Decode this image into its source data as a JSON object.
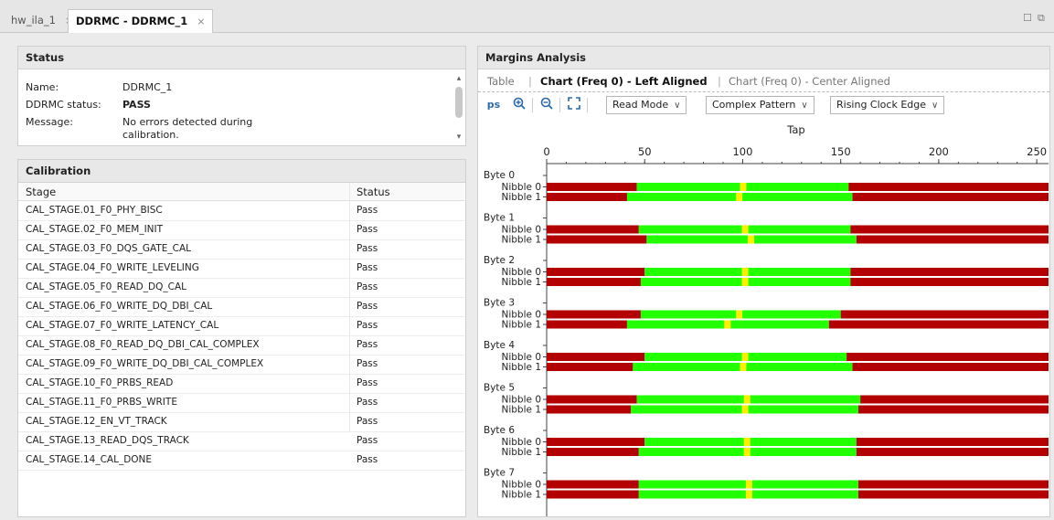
{
  "tabs": [
    {
      "label": "hw_ila_1",
      "close": "×"
    },
    {
      "label": "DDRMC - DDRMC_1",
      "close": "×"
    }
  ],
  "window_controls": {
    "restore": "☐",
    "float": "⧉"
  },
  "status": {
    "title": "Status",
    "name_label": "Name:",
    "name_value": "DDRMC_1",
    "ddrmc_status_label": "DDRMC status:",
    "ddrmc_status_value": "PASS",
    "message_label": "Message:",
    "message_line1": "No errors detected during",
    "message_line2": "calibration."
  },
  "calibration": {
    "title": "Calibration",
    "col_stage": "Stage",
    "col_status": "Status",
    "rows": [
      {
        "stage": "CAL_STAGE.01_F0_PHY_BISC",
        "status": "Pass"
      },
      {
        "stage": "CAL_STAGE.02_F0_MEM_INIT",
        "status": "Pass"
      },
      {
        "stage": "CAL_STAGE.03_F0_DQS_GATE_CAL",
        "status": "Pass"
      },
      {
        "stage": "CAL_STAGE.04_F0_WRITE_LEVELING",
        "status": "Pass"
      },
      {
        "stage": "CAL_STAGE.05_F0_READ_DQ_CAL",
        "status": "Pass"
      },
      {
        "stage": "CAL_STAGE.06_F0_WRITE_DQ_DBI_CAL",
        "status": "Pass"
      },
      {
        "stage": "CAL_STAGE.07_F0_WRITE_LATENCY_CAL",
        "status": "Pass"
      },
      {
        "stage": "CAL_STAGE.08_F0_READ_DQ_DBI_CAL_COMPLEX",
        "status": "Pass"
      },
      {
        "stage": "CAL_STAGE.09_F0_WRITE_DQ_DBI_CAL_COMPLEX",
        "status": "Pass"
      },
      {
        "stage": "CAL_STAGE.10_F0_PRBS_READ",
        "status": "Pass"
      },
      {
        "stage": "CAL_STAGE.11_F0_PRBS_WRITE",
        "status": "Pass"
      },
      {
        "stage": "CAL_STAGE.12_EN_VT_TRACK",
        "status": "Pass"
      },
      {
        "stage": "CAL_STAGE.13_READ_DQS_TRACK",
        "status": "Pass"
      },
      {
        "stage": "CAL_STAGE.14_CAL_DONE",
        "status": "Pass"
      }
    ]
  },
  "margins": {
    "title": "Margins Analysis",
    "subtabs": {
      "table": "Table",
      "left": "Chart (Freq 0) - Left Aligned",
      "center": "Chart (Freq 0) - Center Aligned",
      "sep": "|"
    },
    "toolbar": {
      "ps_label": "ps",
      "read_mode": "Read Mode",
      "pattern": "Complex Pattern",
      "edge": "Rising Clock Edge",
      "chevron": "∨"
    }
  },
  "colors": {
    "fail": "#b30000",
    "pass": "#22ff00",
    "center": "#ffee00"
  },
  "chart_data": {
    "type": "bar",
    "xlabel": "Tap",
    "xlim": [
      0,
      256
    ],
    "xticks": [
      0,
      50,
      100,
      150,
      200,
      250
    ],
    "groups": [
      {
        "label": "Byte 0",
        "nibbles": [
          {
            "label": "Nibble 0",
            "pass_start": 46,
            "pass_end": 154,
            "center": 100
          },
          {
            "label": "Nibble 1",
            "pass_start": 41,
            "pass_end": 156,
            "center": 98
          }
        ]
      },
      {
        "label": "Byte 1",
        "nibbles": [
          {
            "label": "Nibble 0",
            "pass_start": 47,
            "pass_end": 155,
            "center": 101
          },
          {
            "label": "Nibble 1",
            "pass_start": 51,
            "pass_end": 158,
            "center": 104
          }
        ]
      },
      {
        "label": "Byte 2",
        "nibbles": [
          {
            "label": "Nibble 0",
            "pass_start": 50,
            "pass_end": 155,
            "center": 101
          },
          {
            "label": "Nibble 1",
            "pass_start": 48,
            "pass_end": 155,
            "center": 101
          }
        ]
      },
      {
        "label": "Byte 3",
        "nibbles": [
          {
            "label": "Nibble 0",
            "pass_start": 48,
            "pass_end": 150,
            "center": 98
          },
          {
            "label": "Nibble 1",
            "pass_start": 41,
            "pass_end": 144,
            "center": 92
          }
        ]
      },
      {
        "label": "Byte 4",
        "nibbles": [
          {
            "label": "Nibble 0",
            "pass_start": 50,
            "pass_end": 153,
            "center": 101
          },
          {
            "label": "Nibble 1",
            "pass_start": 44,
            "pass_end": 156,
            "center": 100
          }
        ]
      },
      {
        "label": "Byte 5",
        "nibbles": [
          {
            "label": "Nibble 0",
            "pass_start": 46,
            "pass_end": 160,
            "center": 102
          },
          {
            "label": "Nibble 1",
            "pass_start": 43,
            "pass_end": 159,
            "center": 101
          }
        ]
      },
      {
        "label": "Byte 6",
        "nibbles": [
          {
            "label": "Nibble 0",
            "pass_start": 50,
            "pass_end": 158,
            "center": 102
          },
          {
            "label": "Nibble 1",
            "pass_start": 47,
            "pass_end": 158,
            "center": 102
          }
        ]
      },
      {
        "label": "Byte 7",
        "nibbles": [
          {
            "label": "Nibble 0",
            "pass_start": 47,
            "pass_end": 159,
            "center": 103
          },
          {
            "label": "Nibble 1",
            "pass_start": 47,
            "pass_end": 159,
            "center": 103
          }
        ]
      }
    ]
  }
}
